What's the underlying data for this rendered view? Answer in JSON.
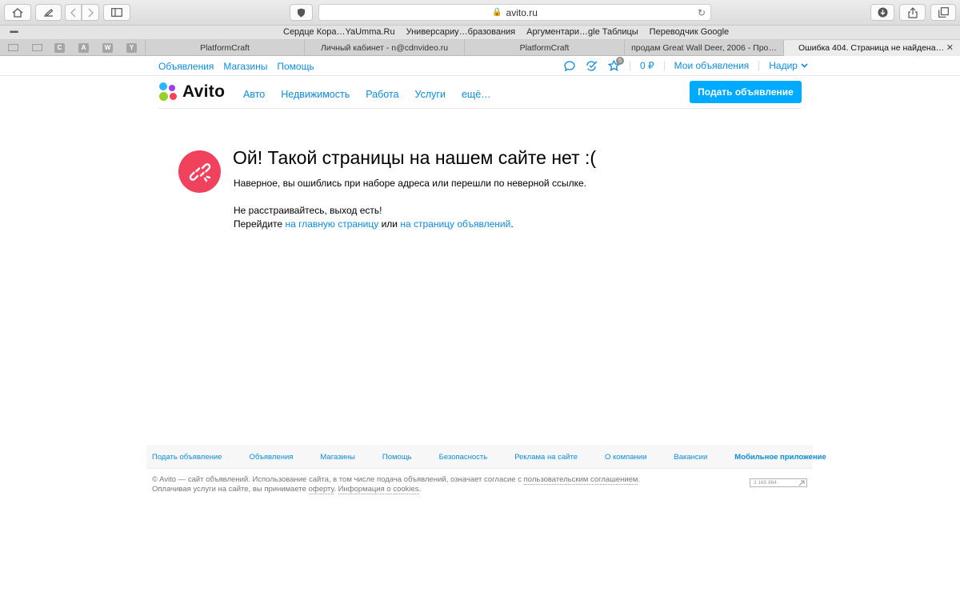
{
  "browser": {
    "url": "avito.ru",
    "favorites": [
      "Сердце Кора…YaUmma.Ru",
      "Универсариу…бразования",
      "Аргументари…gle Таблицы",
      "Переводчик Google"
    ],
    "pinned": [
      "C",
      "A",
      "W",
      "Y"
    ],
    "tabs": [
      "PlatformCraft",
      "Личный кабинет - n@cdnvideo.ru",
      "PlatformCraft",
      "продам Great Wall Deer, 2006 - Про…",
      "Ошибка 404. Страница не найдена…"
    ]
  },
  "topnav": {
    "left": [
      "Объявления",
      "Магазины",
      "Помощь"
    ],
    "favorites_badge": "5",
    "wallet": "0 ₽",
    "my_ads": "Мои объявления",
    "user": "Надир"
  },
  "header": {
    "logo": "Avito",
    "categories": [
      "Авто",
      "Недвижимость",
      "Работа",
      "Услуги",
      "ещё…"
    ],
    "post_button": "Подать объявление"
  },
  "error": {
    "title": "Ой! Такой страницы на нашем сайте нет :(",
    "line1": "Наверное, вы ошиблись при наборе адреса или перешли по неверной ссылке.",
    "line2": "Не расстраивайтесь, выход есть!",
    "line3_prefix": "Перейдите",
    "link_main": "на главную страницу",
    "line3_mid": "или",
    "link_ads": "на страницу объявлений",
    "line3_suffix": "."
  },
  "footer": {
    "links": [
      "Подать объявление",
      "Объявления",
      "Магазины",
      "Помощь",
      "Безопасность",
      "Реклама на сайте",
      "О компании",
      "Вакансии",
      "Мобильное приложение"
    ],
    "copy1_a": "© Avito — сайт объявлений. Использование сайта, в том числе подача объявлений, означает согласие с",
    "copy1_link": "пользовательским соглашением",
    "copy1_end": ".",
    "copy2_a": "Оплачивая услуги на сайте, вы принимаете",
    "copy2_link1": "оферту",
    "copy2_mid": ".",
    "copy2_link2": "Информация о cookies",
    "copy2_end": ".",
    "counter": "3 165 864"
  },
  "colors": {
    "accent": "#0a8de0",
    "button": "#00aaff",
    "error_icon": "#f0425c"
  }
}
